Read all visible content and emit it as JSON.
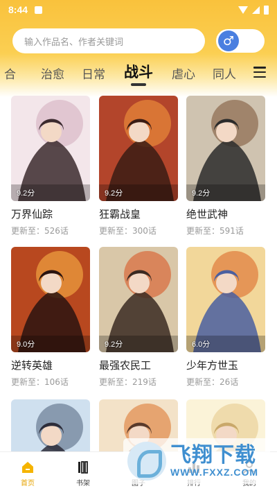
{
  "status_bar": {
    "time": "8:44"
  },
  "search": {
    "placeholder": "输入作品名、作者关键词"
  },
  "gender_toggle": {
    "symbol": "♂",
    "color": "#4a7fe0"
  },
  "tabs": [
    {
      "label": "合"
    },
    {
      "label": "治愈"
    },
    {
      "label": "日常"
    },
    {
      "label": "战斗",
      "active": true
    },
    {
      "label": "虐心"
    },
    {
      "label": "同人"
    }
  ],
  "comics": [
    {
      "title": "万界仙踪",
      "score": "9.2分",
      "update": "更新至：526话",
      "colors": [
        "#f3e6ea",
        "#d9b8c6",
        "#3b2a2e"
      ]
    },
    {
      "title": "狂霸战皇",
      "score": "9.2分",
      "update": "更新至：300话",
      "colors": [
        "#b3452b",
        "#e98a3a",
        "#3a1c14"
      ]
    },
    {
      "title": "绝世武神",
      "score": "9.2分",
      "update": "更新至：591话",
      "colors": [
        "#cfc3b0",
        "#8b6a4f",
        "#2b2b2b"
      ]
    },
    {
      "title": "逆转英雄",
      "score": "9.0分",
      "update": "更新至：106话",
      "colors": [
        "#b8481f",
        "#f0a340",
        "#2a1410"
      ]
    },
    {
      "title": "最强农民工",
      "score": "9.2分",
      "update": "更新至：219话",
      "colors": [
        "#d9c7a8",
        "#d96a3a",
        "#3a2a22"
      ]
    },
    {
      "title": "少年方世玉",
      "score": "6.0分",
      "update": "更新至：26话",
      "colors": [
        "#f2d79a",
        "#e07b3a",
        "#4a5fa0"
      ]
    },
    {
      "title": "",
      "score": "",
      "update": "",
      "colors": [
        "#cfe0ef",
        "#6a7c94",
        "#2d2d3a"
      ]
    },
    {
      "title": "",
      "score": "",
      "update": "",
      "colors": [
        "#f3e2c8",
        "#e08a4a",
        "#5a3a2a"
      ]
    },
    {
      "title": "",
      "score": "",
      "update": "",
      "colors": [
        "#fbf3d8",
        "#ead09a",
        "#c9a86a"
      ]
    }
  ],
  "bottom_nav": [
    {
      "label": "首页",
      "icon": "home-icon",
      "active": true
    },
    {
      "label": "书架",
      "icon": "bookshelf-icon"
    },
    {
      "label": "图子",
      "icon": "circle-icon"
    },
    {
      "label": "排行",
      "icon": "ranking-icon"
    },
    {
      "label": "我的",
      "icon": "profile-icon"
    }
  ],
  "watermark": {
    "text": "飞翔下载",
    "url": "WWW.FXXZ.COM"
  },
  "colors": {
    "accent": "#f9c23c",
    "active_nav": "#e6a300"
  }
}
